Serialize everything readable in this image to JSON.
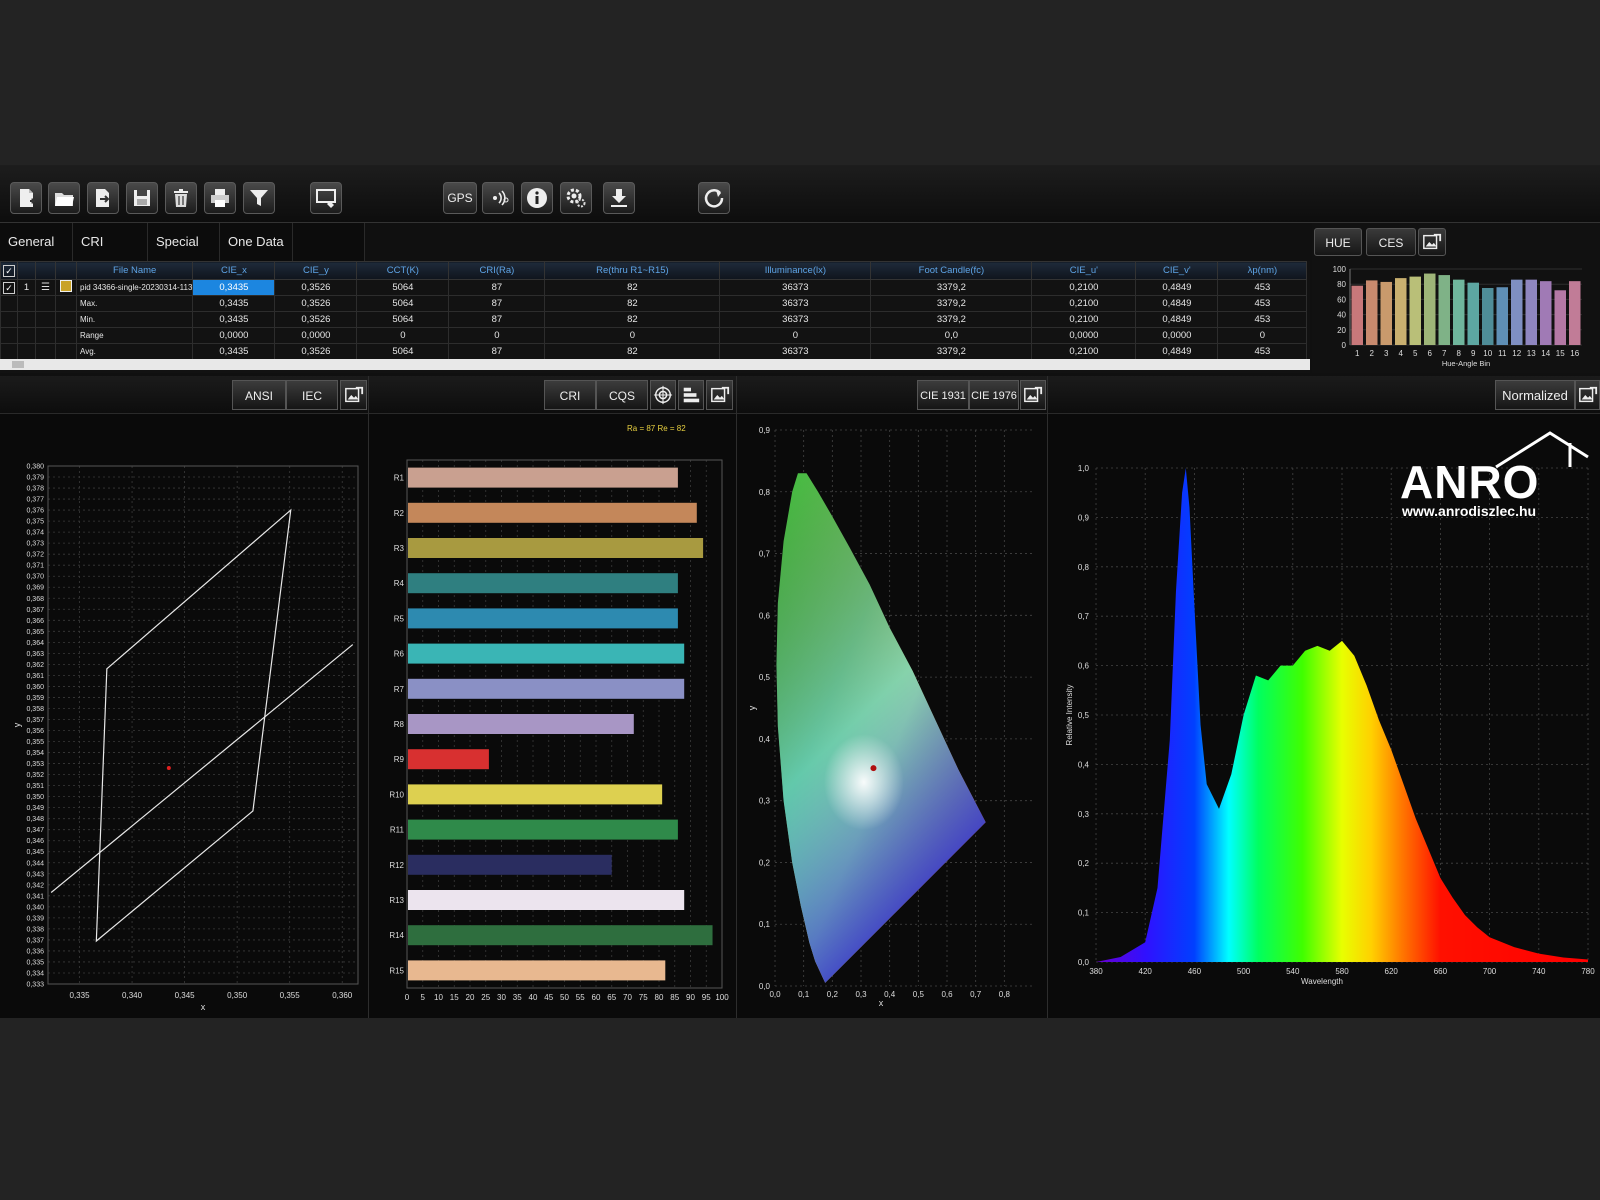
{
  "toolbar": {
    "gps_label": "GPS"
  },
  "tabs": [
    "General",
    "CRI",
    "Special",
    "One Data"
  ],
  "table": {
    "headers": [
      "File Name",
      "CIE_x",
      "CIE_y",
      "CCT(K)",
      "CRI(Ra)",
      "Re(thru R1~R15)",
      "Illuminance(lx)",
      "Foot Candle(fc)",
      "CIE_u'",
      "CIE_v'",
      "λp(nm)"
    ],
    "rows": [
      {
        "idx": "1",
        "name": "pid 34366-single-20230314-113",
        "cells": [
          "0,3435",
          "0,3526",
          "5064",
          "87",
          "82",
          "36373",
          "3379,2",
          "0,2100",
          "0,4849",
          "453"
        ]
      },
      {
        "idx": "",
        "name": "Max.",
        "cells": [
          "0,3435",
          "0,3526",
          "5064",
          "87",
          "82",
          "36373",
          "3379,2",
          "0,2100",
          "0,4849",
          "453"
        ]
      },
      {
        "idx": "",
        "name": "Min.",
        "cells": [
          "0,3435",
          "0,3526",
          "5064",
          "87",
          "82",
          "36373",
          "3379,2",
          "0,2100",
          "0,4849",
          "453"
        ]
      },
      {
        "idx": "",
        "name": "Range",
        "cells": [
          "0,0000",
          "0,0000",
          "0",
          "0",
          "0",
          "0",
          "0,0",
          "0,0000",
          "0,0000",
          "0"
        ]
      },
      {
        "idx": "",
        "name": "Avg.",
        "cells": [
          "0,3435",
          "0,3526",
          "5064",
          "87",
          "82",
          "36373",
          "3379,2",
          "0,2100",
          "0,4849",
          "453"
        ]
      }
    ]
  },
  "hue_panel": {
    "buttons": [
      "HUE",
      "CES"
    ],
    "xlabel": "Hue-Angle Bin"
  },
  "panels": {
    "ansi": {
      "buttons": [
        "ANSI",
        "IEC"
      ]
    },
    "cri": {
      "buttons": [
        "CRI",
        "CQS"
      ]
    },
    "cie": {
      "buttons": [
        "CIE 1931",
        "CIE 1976"
      ]
    },
    "spectrum": {
      "buttons": [
        "Normalized"
      ]
    }
  },
  "logo": {
    "word": "ANRO",
    "url": "www.anrodiszlec.hu"
  },
  "chart_data": [
    {
      "type": "bar",
      "name": "hue-bins",
      "categories": [
        "1",
        "2",
        "3",
        "4",
        "5",
        "6",
        "7",
        "8",
        "9",
        "10",
        "11",
        "12",
        "13",
        "14",
        "15",
        "16"
      ],
      "values": [
        78,
        85,
        83,
        88,
        90,
        94,
        92,
        86,
        82,
        75,
        76,
        86,
        86,
        84,
        72,
        84
      ],
      "colors": [
        "#c8787a",
        "#c88a6e",
        "#c99a6c",
        "#c9b070",
        "#b9bf78",
        "#9eb578",
        "#7fb287",
        "#6fb59c",
        "#5da7a2",
        "#4f8d98",
        "#5f8fb5",
        "#7f8fc2",
        "#8f86c0",
        "#a07ab5",
        "#b478a5",
        "#c17c97"
      ],
      "xlabel": "Hue-Angle Bin",
      "ylim": [
        0,
        100
      ],
      "yticks": [
        "0",
        "20",
        "40",
        "60",
        "80",
        "100"
      ]
    },
    {
      "type": "line",
      "name": "ansi-quadrangle",
      "xlabel": "x",
      "ylabel": "y",
      "xlim": [
        0.332,
        0.3615
      ],
      "ylim": [
        0.333,
        0.38
      ],
      "xticks": [
        "0,335",
        "0,340",
        "0,345",
        "0,350",
        "0,355",
        "0,360"
      ],
      "yticks": [
        "0,333",
        "0,334",
        "0,335",
        "0,336",
        "0,337",
        "0,338",
        "0,339",
        "0,340",
        "0,341",
        "0,342",
        "0,343",
        "0,344",
        "0,345",
        "0,346",
        "0,347",
        "0,348",
        "0,349",
        "0,350",
        "0,351",
        "0,352",
        "0,353",
        "0,354",
        "0,355",
        "0,356",
        "0,357",
        "0,358",
        "0,359",
        "0,360",
        "0,361",
        "0,362",
        "0,363",
        "0,364",
        "0,365",
        "0,366",
        "0,367",
        "0,368",
        "0,369",
        "0,370",
        "0,371",
        "0,372",
        "0,373",
        "0,374",
        "0,375",
        "0,376",
        "0,377",
        "0,378",
        "0,379",
        "0,380"
      ],
      "quad": [
        [
          0.3376,
          0.3616
        ],
        [
          0.3551,
          0.376
        ],
        [
          0.3515,
          0.3487
        ],
        [
          0.3366,
          0.3369
        ]
      ],
      "line": [
        [
          0.3323,
          0.3413
        ],
        [
          0.361,
          0.3638
        ]
      ],
      "point": [
        0.3435,
        0.3526
      ]
    },
    {
      "type": "bar",
      "name": "cri-bars",
      "categories": [
        "R1",
        "R2",
        "R3",
        "R4",
        "R5",
        "R6",
        "R7",
        "R8",
        "R9",
        "R10",
        "R11",
        "R12",
        "R13",
        "R14",
        "R15"
      ],
      "values": [
        86,
        92,
        94,
        86,
        86,
        88,
        88,
        72,
        26,
        81,
        86,
        65,
        88,
        97,
        82
      ],
      "colors": [
        "#c9a090",
        "#c4875a",
        "#a89a40",
        "#2f7f80",
        "#2d8ab0",
        "#3ab5b5",
        "#8a90c5",
        "#a896c5",
        "#d83030",
        "#ddd050",
        "#2f8a4a",
        "#2a2d60",
        "#ece4ee",
        "#2e6e3e",
        "#e8b890"
      ],
      "annotation": "Ra = 87   Re = 82",
      "xlim": [
        0,
        100
      ],
      "xticks": [
        "0",
        "5",
        "10",
        "15",
        "20",
        "25",
        "30",
        "35",
        "40",
        "45",
        "50",
        "55",
        "60",
        "65",
        "70",
        "75",
        "80",
        "85",
        "90",
        "95",
        "100"
      ]
    },
    {
      "type": "scatter",
      "name": "cie-1931",
      "xlabel": "x",
      "ylabel": "y",
      "xlim": [
        0,
        0.9
      ],
      "ylim": [
        0,
        0.9
      ],
      "xticks": [
        "0,0",
        "0,1",
        "0,2",
        "0,3",
        "0,4",
        "0,5",
        "0,6",
        "0,7",
        "0,8"
      ],
      "yticks": [
        "0,0",
        "0,1",
        "0,2",
        "0,3",
        "0,4",
        "0,5",
        "0,6",
        "0,7",
        "0,8",
        "0,9"
      ],
      "point": [
        0.3435,
        0.3526
      ]
    },
    {
      "type": "area",
      "name": "spectrum",
      "xlabel": "Wavelength",
      "ylabel": "Relative Intensity",
      "xlim": [
        380,
        780
      ],
      "ylim": [
        0,
        1.0
      ],
      "xticks": [
        "380",
        "420",
        "460",
        "500",
        "540",
        "580",
        "620",
        "660",
        "700",
        "740",
        "780"
      ],
      "yticks": [
        "0,0",
        "0,1",
        "0,2",
        "0,3",
        "0,4",
        "0,5",
        "0,6",
        "0,7",
        "0,8",
        "0,9",
        "1,0"
      ],
      "x": [
        380,
        400,
        420,
        430,
        440,
        445,
        450,
        453,
        456,
        460,
        465,
        470,
        480,
        490,
        500,
        510,
        520,
        530,
        540,
        550,
        560,
        570,
        580,
        590,
        600,
        610,
        620,
        630,
        640,
        650,
        660,
        670,
        680,
        690,
        700,
        720,
        740,
        760,
        780
      ],
      "y": [
        0.0,
        0.01,
        0.04,
        0.15,
        0.45,
        0.75,
        0.95,
        1.0,
        0.92,
        0.72,
        0.48,
        0.36,
        0.31,
        0.38,
        0.5,
        0.58,
        0.57,
        0.6,
        0.6,
        0.63,
        0.64,
        0.63,
        0.65,
        0.62,
        0.56,
        0.49,
        0.43,
        0.36,
        0.29,
        0.23,
        0.17,
        0.13,
        0.095,
        0.07,
        0.05,
        0.03,
        0.017,
        0.009,
        0.005
      ]
    }
  ]
}
